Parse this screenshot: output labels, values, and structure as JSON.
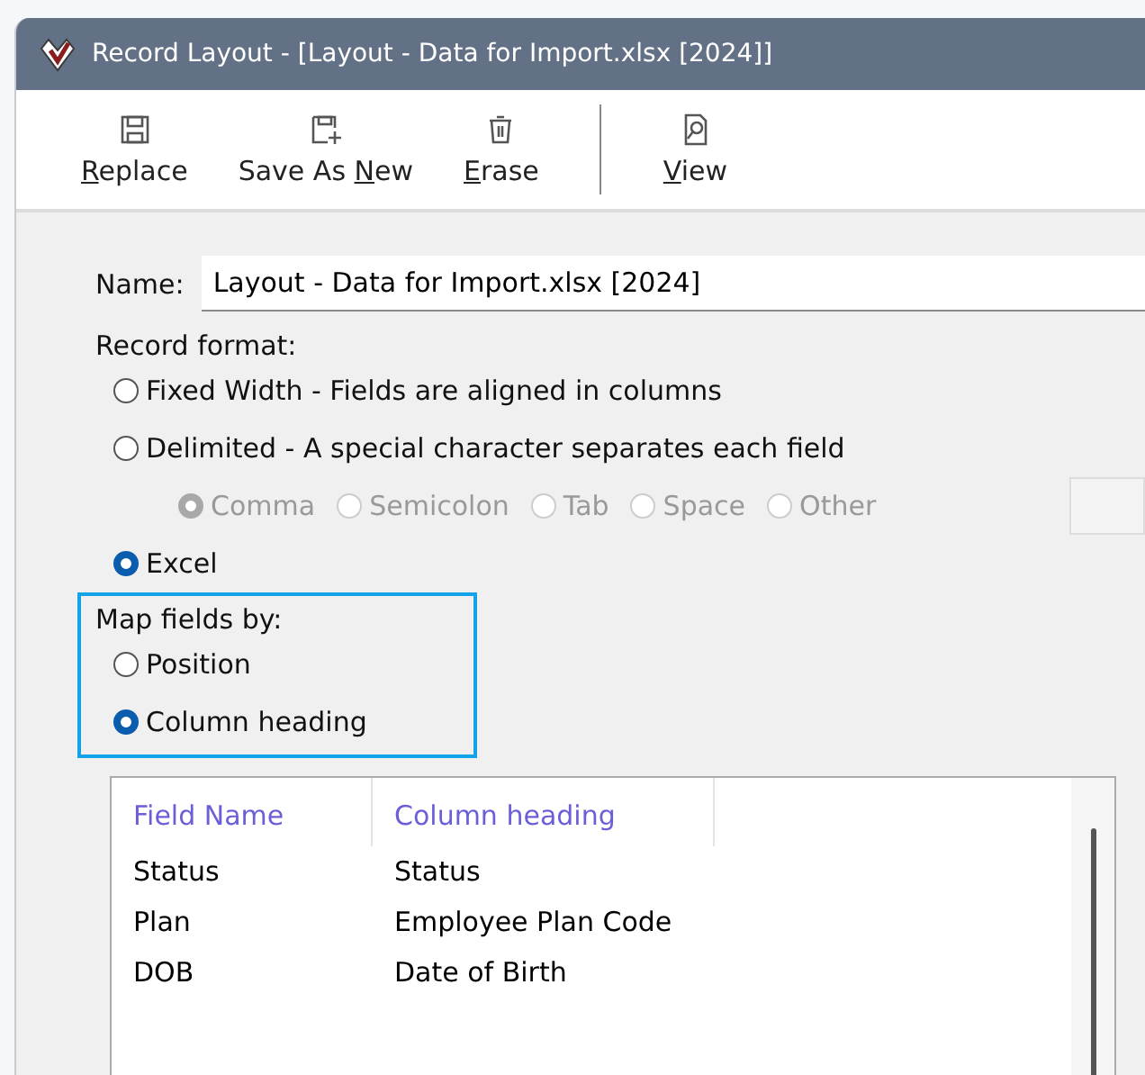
{
  "window": {
    "title": "Record Layout - [Layout - Data for Import.xlsx [2024]]"
  },
  "toolbar": [
    [
      {
        "key": "R",
        "after": "eplace"
      },
      {
        "before": "Save As ",
        "key": "N",
        "after": "ew"
      },
      {
        "key": "E",
        "after": "rase"
      }
    ],
    [
      {
        "key": "V",
        "after": "iew"
      }
    ]
  ],
  "name": {
    "label": "Name:",
    "value": "Layout - Data for Import.xlsx [2024]"
  },
  "record_format": {
    "label": "Record format:",
    "options": [
      {
        "label": "Fixed Width - Fields are aligned in columns",
        "selected": false
      },
      {
        "label": "Delimited - A special character separates each field",
        "selected": false
      }
    ],
    "delimiters": [
      {
        "label": "Comma",
        "selected": true,
        "disabled": true
      },
      {
        "label": "Semicolon",
        "selected": false,
        "disabled": true
      },
      {
        "label": "Tab",
        "selected": false,
        "disabled": true
      },
      {
        "label": "Space",
        "selected": false,
        "disabled": true
      },
      {
        "label": "Other",
        "selected": false,
        "disabled": true
      }
    ],
    "excel": {
      "label": "Excel",
      "selected": true
    }
  },
  "map_fields": {
    "label": "Map fields by:",
    "options": [
      {
        "label": "Position",
        "selected": false
      },
      {
        "label": "Column heading",
        "selected": true
      }
    ]
  },
  "table": {
    "columns": [
      "Field Name",
      "Column heading"
    ],
    "rows": [
      [
        "Status",
        "Status"
      ],
      [
        "Plan",
        "Employee Plan Code"
      ],
      [
        "DOB",
        "Date of Birth"
      ]
    ]
  }
}
